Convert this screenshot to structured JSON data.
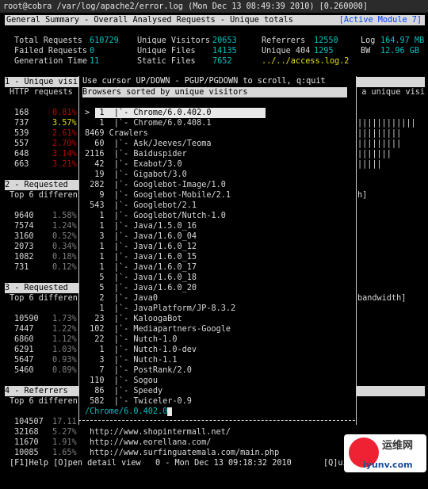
{
  "window": {
    "title": "root@cobra /var/log/apache2/error.log (Mon Dec 13 08:49:39 2010) [0.260000]"
  },
  "header": {
    "title": "General Summary - Overall Analysed Requests - Unique totals",
    "module": "[Active Module 7]"
  },
  "summary": {
    "total_requests_label": "Total Requests",
    "total_requests": "610729",
    "failed_requests_label": "Failed Requests",
    "failed_requests": "0",
    "generation_time_label": "Generation Time",
    "generation_time": "11",
    "unique_visitors_label": "Unique Visitors",
    "unique_visitors": "20653",
    "unique_files_label": "Unique Files",
    "unique_files": "14135",
    "static_files_label": "Static Files",
    "static_files": "7652",
    "referrers_label": "Referrers",
    "referrers": "12550",
    "unique404_label": "Unique 404",
    "unique404": "1295",
    "logfile": "../../access.log.2",
    "log_label": "Log",
    "log_size": "164.97 MB",
    "bw_label": "BW",
    "bw_size": "12.96 GB"
  },
  "sections": {
    "s1": {
      "title": "1 - Unique visi",
      "sub": "HTTP requests ",
      "sub_right": "d a unique visi",
      "rows": [
        {
          "hits": "168",
          "pct": "0.81%",
          "bars": ""
        },
        {
          "hits": "737",
          "pct": "3.57%",
          "bars": "||||||||||||"
        },
        {
          "hits": "539",
          "pct": "2.61%",
          "bars": "|||||||||"
        },
        {
          "hits": "557",
          "pct": "2.70%",
          "bars": "|||||||||"
        },
        {
          "hits": "648",
          "pct": "3.14%",
          "bars": "|||||||"
        },
        {
          "hits": "663",
          "pct": "3.21%",
          "bars": "|||||"
        }
      ]
    },
    "s2": {
      "title": "2 - Requested",
      "sub": "Top 6 differen",
      "sub_right": "h]",
      "rows": [
        {
          "hits": "9640",
          "pct": "1.58%"
        },
        {
          "hits": "7574",
          "pct": "1.24%"
        },
        {
          "hits": "3160",
          "pct": "0.52%"
        },
        {
          "hits": "2073",
          "pct": "0.34%"
        },
        {
          "hits": "1082",
          "pct": "0.18%"
        },
        {
          "hits": "731",
          "pct": "0.12%"
        }
      ]
    },
    "s3": {
      "title": "3 - Requested",
      "sub": "Top 6 differen",
      "sub_right": "bandwidth]",
      "rows": [
        {
          "hits": "10590",
          "pct": "1.73%"
        },
        {
          "hits": "7447",
          "pct": "1.22%"
        },
        {
          "hits": "6860",
          "pct": "1.12%"
        },
        {
          "hits": "6291",
          "pct": "1.03%"
        },
        {
          "hits": "5647",
          "pct": "0.93%"
        },
        {
          "hits": "5460",
          "pct": "0.89%"
        }
      ]
    },
    "s4": {
      "title": "4 - Referrers",
      "sub": "Top 6 differen",
      "rows": [
        {
          "hits": "104507",
          "pct": "17.11",
          "url": ""
        },
        {
          "hits": "32168",
          "pct": "5.27%",
          "url": "http://www.shopintermall.net/"
        },
        {
          "hits": "11670",
          "pct": "1.91%",
          "url": "http://www.eorellana.com/"
        },
        {
          "hits": "10085",
          "pct": "1.65%",
          "url": "http://www.surfinguatemala.com/main.php"
        }
      ]
    }
  },
  "modal": {
    "help": "Use cursor UP/DOWN - PGUP/PGDOWN to scroll, q:quit",
    "header": "Browsers sorted by unique visitors",
    "search": "/Chrome/6.0.402.0",
    "rows": [
      {
        "text": ">  1  |`- Chrome/6.0.402.0"
      },
      {
        "text": "   1  |`- Chrome/6.0.408.1"
      },
      {
        "text": "8469 Crawlers"
      },
      {
        "text": "  60  |`- Ask/Jeeves/Teoma"
      },
      {
        "text": "2116  |`- Baiduspider"
      },
      {
        "text": "  42  |`- Exabot/3.0"
      },
      {
        "text": "  19  |`- Gigabot/3.0"
      },
      {
        "text": " 282  |`- Googlebot-Image/1.0"
      },
      {
        "text": "   9  |`- Googlebot-Mobile/2.1"
      },
      {
        "text": " 543  |`- Googlebot/2.1"
      },
      {
        "text": "   1  |`- Googlebot/Nutch-1.0"
      },
      {
        "text": "   1  |`- Java/1.5.0_16"
      },
      {
        "text": "   3  |`- Java/1.6.0_04"
      },
      {
        "text": "   1  |`- Java/1.6.0_12"
      },
      {
        "text": "   1  |`- Java/1.6.0_15"
      },
      {
        "text": "   1  |`- Java/1.6.0_17"
      },
      {
        "text": "   5  |`- Java/1.6.0_18"
      },
      {
        "text": "   5  |`- Java/1.6.0_20"
      },
      {
        "text": "   2  |`- Java0"
      },
      {
        "text": "   1  |`- JavaPlatform/JP-8.3.2"
      },
      {
        "text": "  23  |`- KaloogaBot"
      },
      {
        "text": " 102  |`- Mediapartners-Google"
      },
      {
        "text": "  22  |`- Nutch-1.0"
      },
      {
        "text": "   1  |`- Nutch-1.0-dev"
      },
      {
        "text": "   3  |`- Nutch-1.1"
      },
      {
        "text": "   7  |`- PostRank/2.0"
      },
      {
        "text": " 110  |`- Sogou"
      },
      {
        "text": "  86  |`- Speedy"
      },
      {
        "text": " 582  |`- Twiceler-0.9"
      }
    ]
  },
  "footer": {
    "help": "[F1]Help [O]pen detail view   0 - Mon Dec 13 09:18:32 2010",
    "quit": "[Q]uit"
  },
  "watermark": {
    "line1": "运维网",
    "line2": "iyunv.com"
  }
}
